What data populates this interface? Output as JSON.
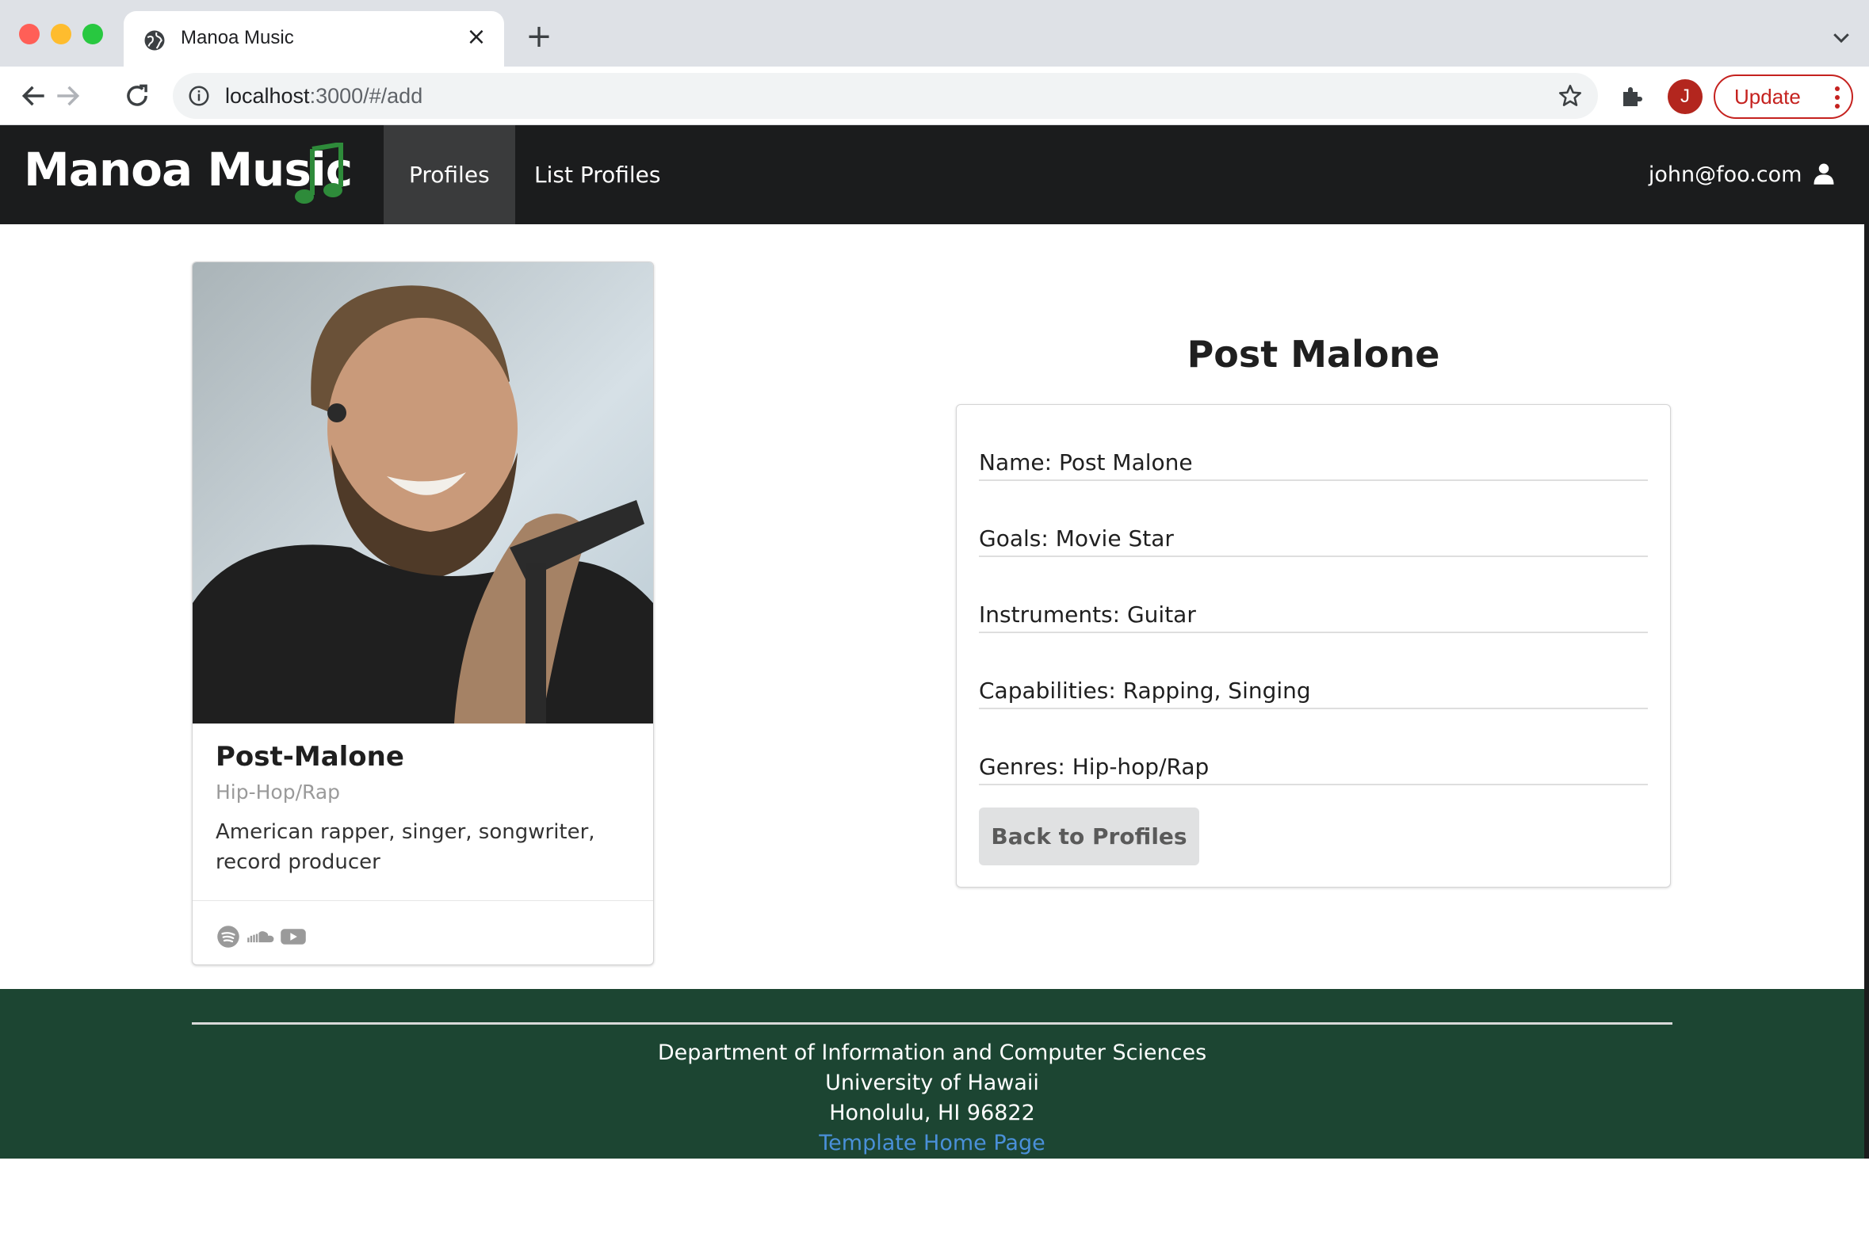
{
  "browser": {
    "tab_title": "Manoa Music",
    "url_host": "localhost",
    "url_rest": ":3000/#/add",
    "profile_initial": "J",
    "update_label": "Update"
  },
  "navbar": {
    "brand": "Manoa Music",
    "items": [
      {
        "label": "Profiles",
        "active": true
      },
      {
        "label": "List Profiles",
        "active": false
      }
    ],
    "user": "john@foo.com"
  },
  "card": {
    "name": "Post-Malone",
    "genre": "Hip-Hop/Rap",
    "description": "American rapper, singer, songwriter, record producer",
    "social_icons": [
      "spotify-icon",
      "soundcloud-icon",
      "youtube-icon"
    ]
  },
  "details": {
    "title": "Post Malone",
    "rows": [
      "Name: Post Malone",
      "Goals: Movie Star",
      "Instruments: Guitar",
      "Capabilities: Rapping, Singing",
      "Genres: Hip-hop/Rap"
    ],
    "back_label": "Back to Profiles"
  },
  "footer": {
    "line1": "Department of Information and Computer Sciences",
    "line2": "University of Hawaii",
    "line3": "Honolulu, HI 96822",
    "link": "Template Home Page"
  },
  "colors": {
    "navbar_bg": "#1b1c1d",
    "footer_bg": "#1c4532",
    "note_green": "#2e8b3a",
    "link_blue": "#4a90d9",
    "update_red": "#c5221f"
  }
}
